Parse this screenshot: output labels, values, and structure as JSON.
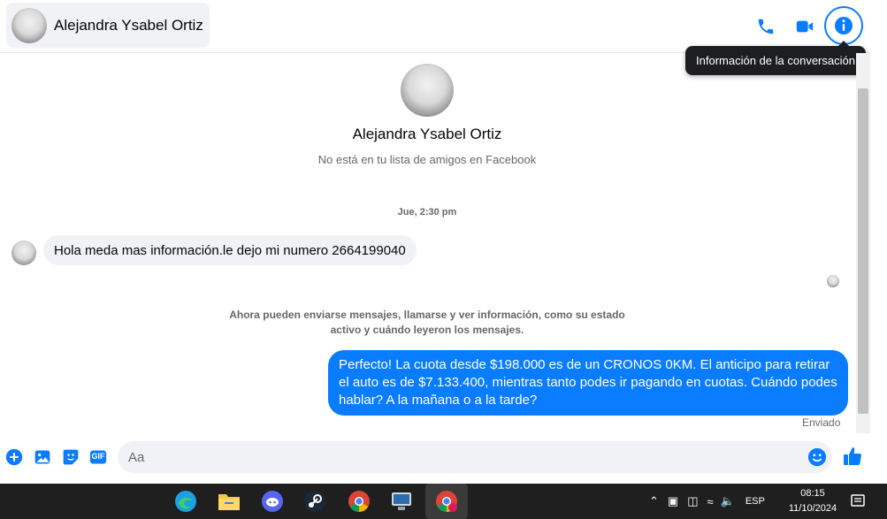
{
  "header": {
    "contact_name": "Alejandra Ysabel Ortiz",
    "tooltip": "Información de la conversación"
  },
  "profile": {
    "name": "Alejandra Ysabel Ortiz",
    "subtitle": "No está en tu lista de amigos en Facebook"
  },
  "conversation": {
    "timestamp": "Jue, 2:30 pm",
    "incoming_message": "Hola meda mas información.le dejo mi numero 2664199040",
    "system_note_line1": "Ahora pueden enviarse mensajes, llamarse y ver información, como su estado",
    "system_note_line2": "activo y cuándo leyeron los mensajes.",
    "outgoing_message": "Perfecto! La cuota desde $198.000 es de un CRONOS 0KM. El anticipo para retirar el auto es de $7.133.400, mientras tanto podes ir pagando en cuotas. Cuándo podes hablar? A la mañana o a la tarde?",
    "status": "Enviado"
  },
  "composer": {
    "placeholder": "Aa",
    "gif_label": "GIF"
  },
  "taskbar": {
    "language": "ESP",
    "time": "08:15",
    "date": "11/10/2024"
  },
  "colors": {
    "accent": "#0a7cff",
    "bubble_in": "#f0f2f5",
    "taskbar": "#1f1f1f"
  },
  "icons": [
    "phone-icon",
    "video-call-icon",
    "info-icon",
    "plus-icon",
    "image-icon",
    "sticker-icon",
    "gif-icon",
    "emoji-icon",
    "like-icon"
  ]
}
